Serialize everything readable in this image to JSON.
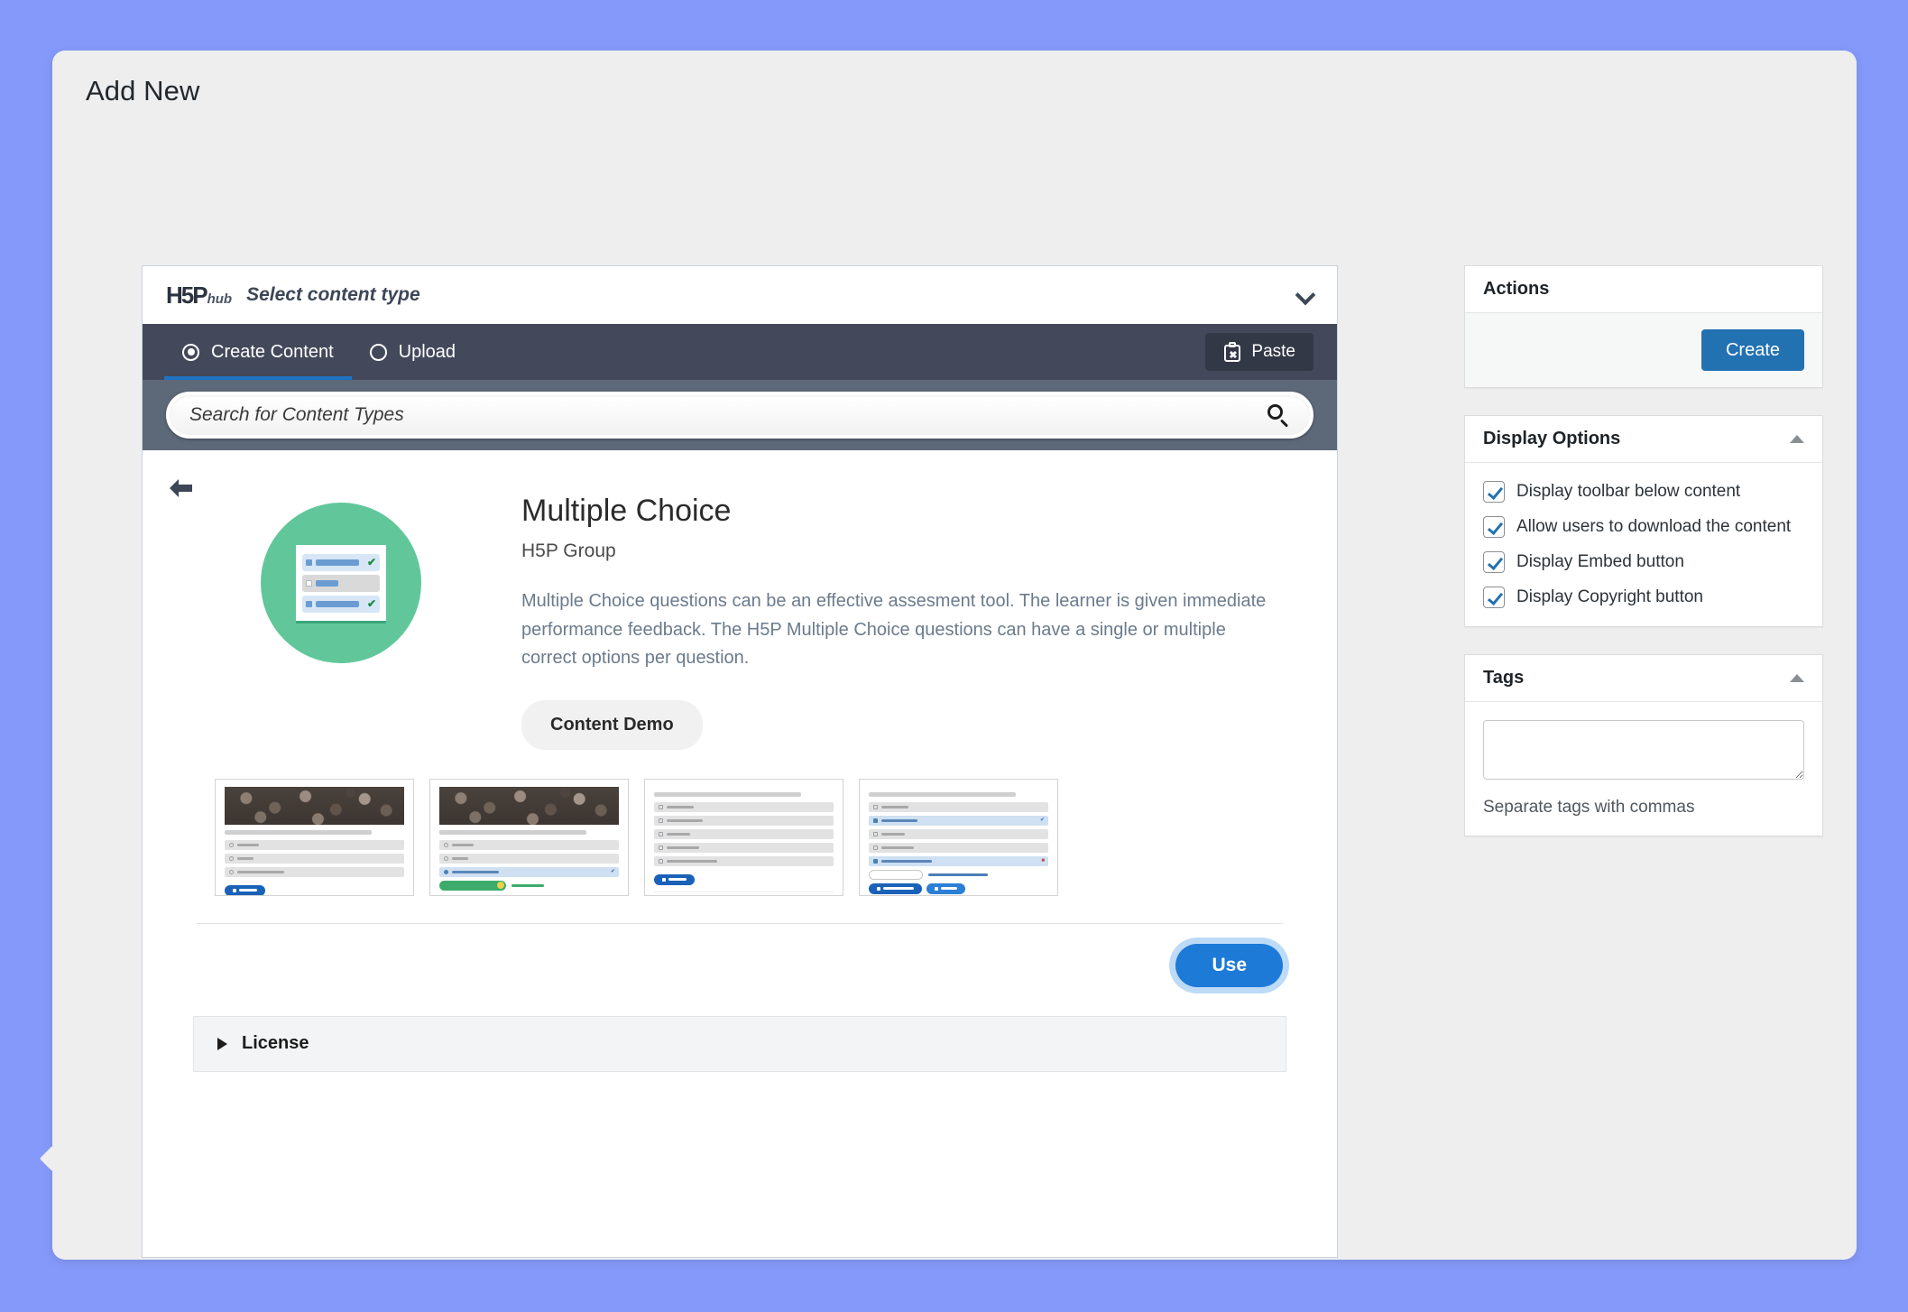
{
  "page": {
    "title": "Add New",
    "background_color": "#8599fa",
    "accent_color": "#2271b1"
  },
  "hub": {
    "logo_mark": "H5P",
    "logo_sub": "hub",
    "header_title": "Select content type",
    "chevron_icon": "chevron-down-icon",
    "tabs": [
      {
        "label": "Create Content",
        "selected": true
      },
      {
        "label": "Upload",
        "selected": false
      }
    ],
    "paste_button": {
      "label": "Paste",
      "icon": "clipboard-x-icon"
    },
    "search": {
      "placeholder": "Search for Content Types",
      "value": "",
      "icon": "search-icon"
    }
  },
  "detail": {
    "back_icon": "arrow-left-icon",
    "icon_name": "multiple-choice-icon",
    "icon_background": "#61c79b",
    "title": "Multiple Choice",
    "subtitle": "H5P Group",
    "description": "Multiple Choice questions can be an effective assesment tool. The learner is given immediate performance feedback. The H5P Multiple Choice questions can have a single or multiple correct options per question.",
    "demo_button": "Content Demo",
    "use_button": "Use",
    "thumbnails": [
      {
        "name": "thumbnail-blackcurrant-question",
        "variant": "image-radio"
      },
      {
        "name": "thumbnail-blackcurrant-answered",
        "variant": "image-radio-correct"
      },
      {
        "name": "thumbnail-checkbox-question",
        "variant": "checkbox"
      },
      {
        "name": "thumbnail-checkbox-result",
        "variant": "checkbox-result"
      }
    ],
    "license": {
      "label": "License",
      "expanded": false
    }
  },
  "sidebar": {
    "actions": {
      "title": "Actions",
      "create_button": "Create"
    },
    "display_options": {
      "title": "Display Options",
      "collapsed": false,
      "options": [
        {
          "label": "Display toolbar below content",
          "checked": true
        },
        {
          "label": "Allow users to download the content",
          "checked": true
        },
        {
          "label": "Display Embed button",
          "checked": true
        },
        {
          "label": "Display Copyright button",
          "checked": true
        }
      ]
    },
    "tags": {
      "title": "Tags",
      "collapsed": false,
      "value": "",
      "help": "Separate tags with commas"
    }
  }
}
